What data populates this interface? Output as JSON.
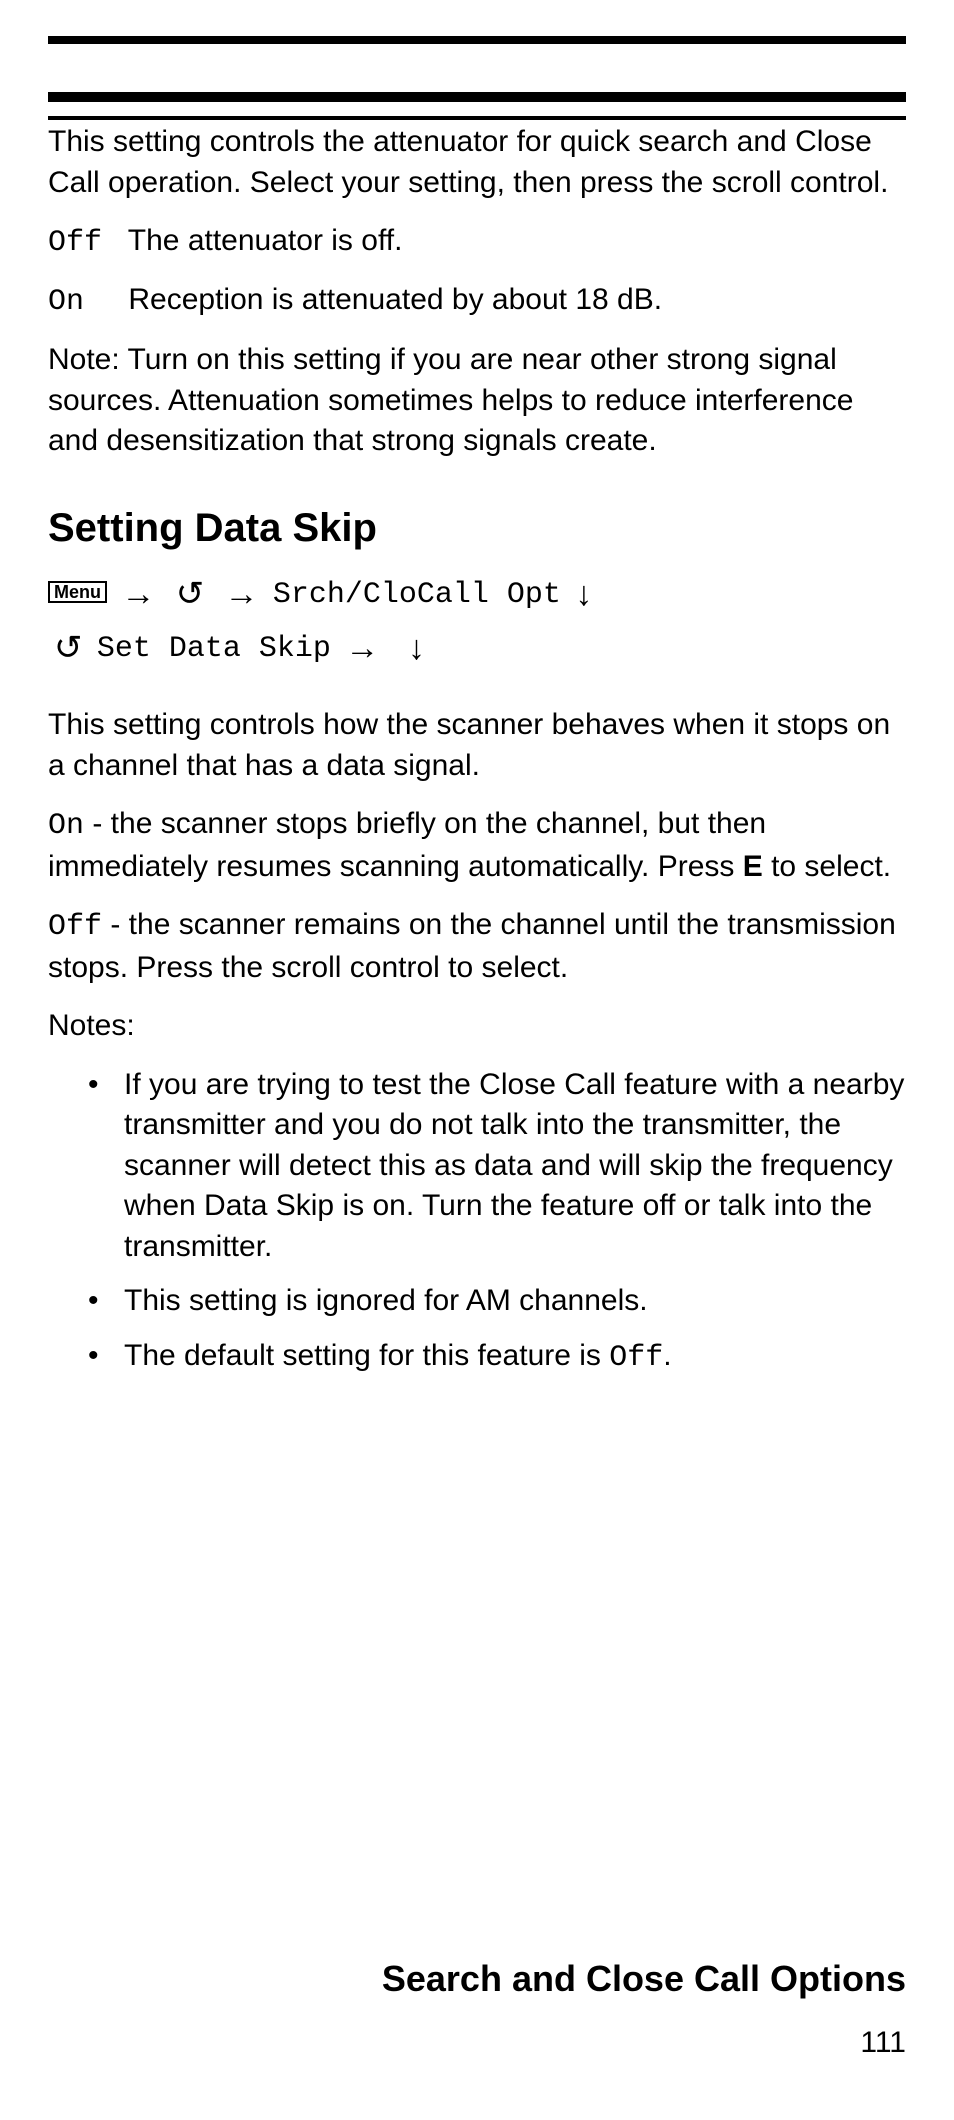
{
  "intro": "This setting controls the attenuator for quick search and Close Call operation. Select your setting, then press the scroll control.",
  "options": {
    "off_label": "Off",
    "off_text": "The attenuator is off.",
    "on_label": "On",
    "on_text": "Reception is attenuated by about 18 dB."
  },
  "note1": "Note: Turn on this setting if you are near other strong signal sources. Attenuation sometimes helps to reduce interference and desensitization that strong signals create.",
  "heading": "Setting Data Skip",
  "nav": {
    "menu": "Menu",
    "path1": "Srch/CloCall Opt",
    "path2": "Set Data Skip"
  },
  "dataskip": {
    "intro": "This setting controls how the scanner behaves when it stops on a channel that has a data signal.",
    "on_label": "On",
    "on_text_before_e": " - the scanner stops briefly on the channel, but then immediately resumes scanning automatically. Press ",
    "on_key": "E",
    "on_text_after_e": " to select.",
    "off_label": "Off",
    "off_text": " - the scanner remains on the channel until the transmission stops. Press the scroll control to select.",
    "notes_label": "Notes:",
    "notes": [
      "If you are trying to test the Close Call feature with a nearby transmitter and you do not talk into the transmitter, the scanner will detect this as data and will skip the frequency when Data Skip is on. Turn the feature off or talk into the transmitter.",
      "This setting is ignored for AM channels."
    ],
    "note3_prefix": "The default setting for this feature is ",
    "note3_value": "Off",
    "note3_suffix": "."
  },
  "footer": {
    "title": "Search and Close Call Options",
    "page": "111"
  }
}
